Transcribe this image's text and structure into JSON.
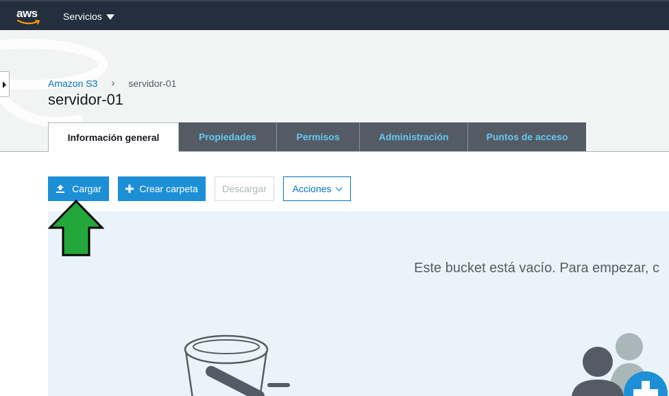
{
  "topnav": {
    "logo_text": "aws",
    "services_label": "Servicios"
  },
  "breadcrumb": {
    "root": "Amazon S3",
    "separator": "›",
    "current": "servidor-01"
  },
  "page": {
    "title": "servidor-01"
  },
  "tabs": [
    {
      "label": "Información general",
      "active": true
    },
    {
      "label": "Propiedades",
      "active": false
    },
    {
      "label": "Permisos",
      "active": false
    },
    {
      "label": "Administración",
      "active": false
    },
    {
      "label": "Puntos de acceso",
      "active": false
    }
  ],
  "toolbar": {
    "upload_label": "Cargar",
    "create_folder_label": "Crear carpeta",
    "download_label": "Descargar",
    "actions_label": "Acciones"
  },
  "empty_state": {
    "message": "Este bucket está vacío. Para empezar, c"
  },
  "icons": {
    "upload": "upload-icon",
    "plus": "plus-icon",
    "caret": "caret-down-icon",
    "chevron": "chevron-down-icon",
    "annotation": "green-up-arrow"
  },
  "colors": {
    "nav_bg": "#232f3e",
    "primary": "#1d8fd6",
    "link": "#0073bb",
    "tab_inactive_bg": "#545b64",
    "tab_inactive_text": "#66c8f4",
    "empty_bg": "#eaf3fa",
    "annotation_arrow": "#22a83a"
  }
}
